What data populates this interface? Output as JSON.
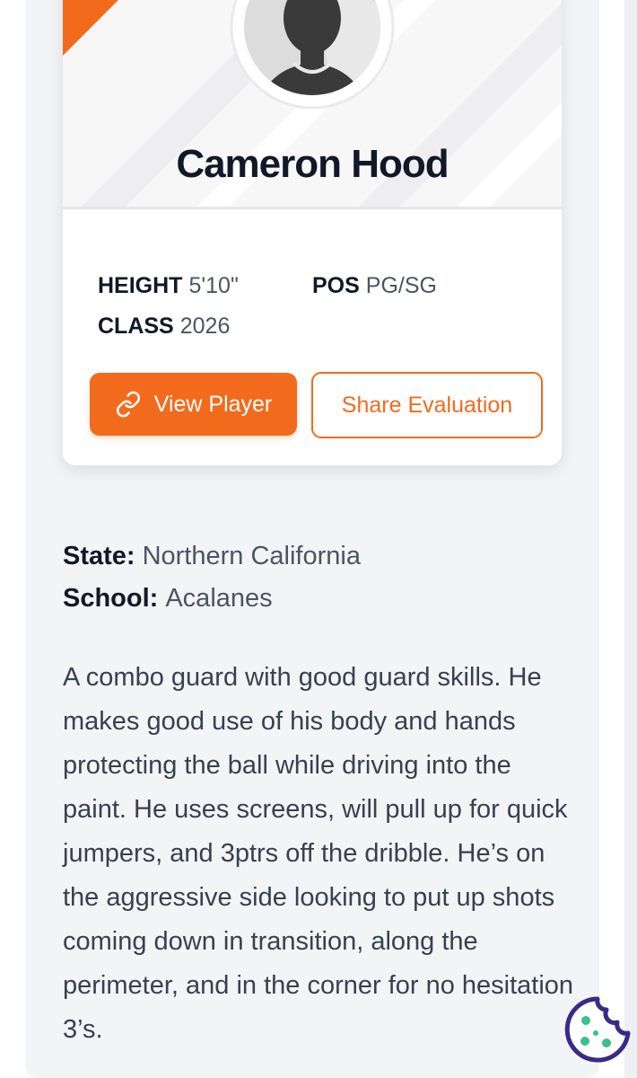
{
  "player": {
    "name": "Cameron Hood",
    "avatar_icon": "person-silhouette-icon"
  },
  "stats": {
    "height_label": "HEIGHT",
    "height_value": "5'10\"",
    "pos_label": "POS",
    "pos_value": "PG/SG",
    "class_label": "CLASS",
    "class_value": "2026"
  },
  "actions": {
    "view_player_label": "View Player",
    "view_player_icon": "link-icon",
    "share_label": "Share Evaluation"
  },
  "details": {
    "state_label": "State:",
    "state_value": "Northern California",
    "school_label": "School:",
    "school_value": "Acalanes"
  },
  "evaluation": {
    "text": "A combo guard with good guard skills. He makes good use of his body and hands protecting the ball while driving into the paint. He uses screens, will pull up for quick jumpers, and 3ptrs off the dribble. He’s on the aggressive side looking to put up shots coming down in transition, along the perimeter, and in the corner for no hesitation 3’s."
  },
  "cookie": {
    "icon": "cookie-icon"
  },
  "colors": {
    "accent": "#f26b1d",
    "heading": "#111827",
    "body_text": "#374151",
    "panel_bg": "#f3f4f6",
    "cookie_purple": "#3b2a85",
    "cookie_dots": "#3dbf8a"
  }
}
